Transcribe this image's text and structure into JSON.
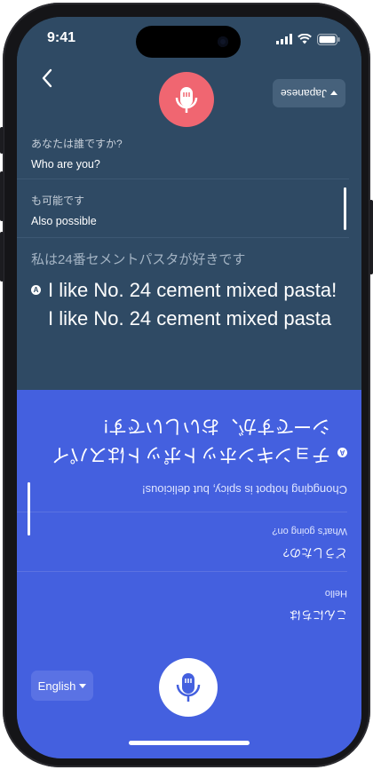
{
  "status_bar": {
    "time": "9:41"
  },
  "top_panel": {
    "language_button": "Japanese",
    "history": [
      {
        "source": "あなたは誰ですか?",
        "translation": "Who are you?"
      },
      {
        "source": "も可能です",
        "translation": "Also possible"
      }
    ],
    "current": {
      "source": "私は24番セメントパスタが好きです",
      "translation": "I like No. 24 cement mixed pasta! I like No. 24 cement mixed pasta"
    }
  },
  "bottom_panel": {
    "language_button": "English",
    "current": {
      "source": "チョンキンホットポットはスパイシーですが、おいしいです!",
      "translation": "Chongqing hotpot is spicy, but delicious!"
    },
    "history": [
      {
        "source": "どうしたの?",
        "translation": "What's going on?"
      },
      {
        "source": "こんにちは",
        "translation": "Hello"
      }
    ]
  },
  "colors": {
    "top_bg": "#2f4a64",
    "bottom_bg": "#4460df",
    "mic_active": "#f06671"
  },
  "icons": [
    "back-chevron-icon",
    "microphone-icon",
    "dropdown-caret-icon",
    "signal-icon",
    "wifi-icon",
    "battery-icon"
  ]
}
